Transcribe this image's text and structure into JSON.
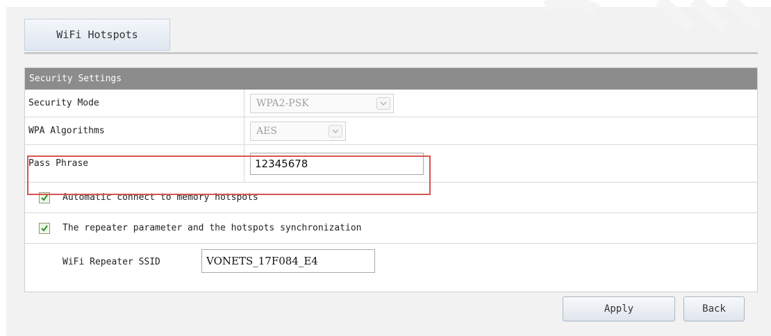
{
  "tab": {
    "label": "WiFi Hotspots"
  },
  "section": {
    "title": "Security Settings"
  },
  "rows": {
    "security_mode": {
      "label": "Security Mode",
      "value": "WPA2-PSK"
    },
    "wpa_algorithms": {
      "label": "WPA Algorithms",
      "value": "AES"
    },
    "pass_phrase": {
      "label": "Pass Phrase",
      "value": "12345678"
    },
    "auto_connect": {
      "label": "Automatic connect to memory hotspots",
      "checked": true
    },
    "repeater_sync": {
      "label": "The repeater parameter and the hotspots synchronization",
      "checked": true
    },
    "repeater_ssid": {
      "label": "WiFi Repeater SSID",
      "value": "VONETS_17F084_E4"
    }
  },
  "buttons": {
    "apply": "Apply",
    "back": "Back"
  },
  "colors": {
    "header_bg": "#8c8c8c",
    "highlight": "#d9534f",
    "checkbox_mark": "#2e8b2e"
  }
}
